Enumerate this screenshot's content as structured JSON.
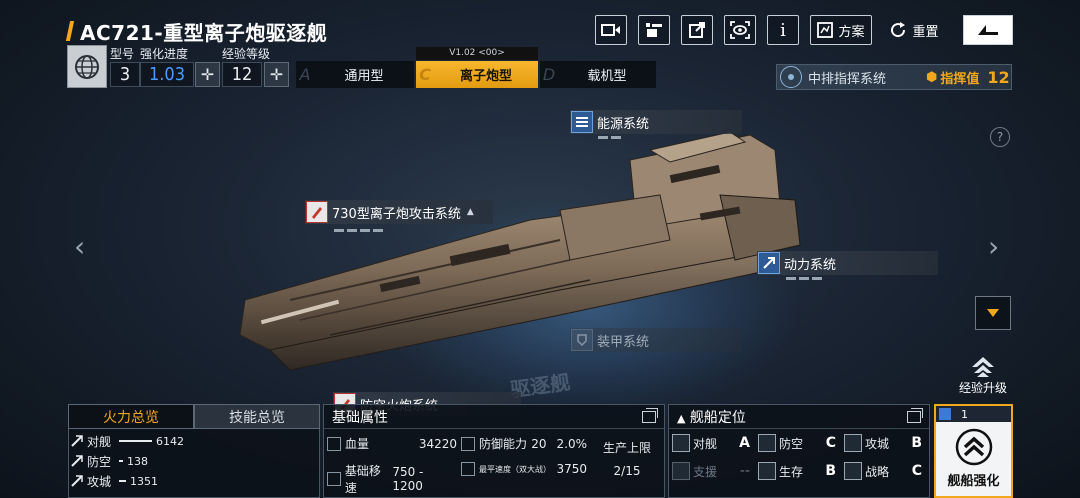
{
  "header": {
    "title": "AC721-重型离子炮驱逐舰",
    "stats": {
      "labels": [
        "型号",
        "强化进度",
        "经验等级"
      ],
      "model": "3",
      "progress": "1.03",
      "level": "12"
    },
    "buttons": {
      "plan": "方案",
      "reset": "重置"
    }
  },
  "modes": {
    "version": "V1.02 <00>",
    "tabs": [
      {
        "letter": "A",
        "label": "通用型"
      },
      {
        "letter": "C",
        "label": "离子炮型"
      },
      {
        "letter": "D",
        "label": "载机型"
      }
    ]
  },
  "command": {
    "name": "中排指挥系统",
    "value_label": "指挥值",
    "value": "12"
  },
  "systems": {
    "energy": "能源系统",
    "ion": "730型离子炮攻击系统",
    "power": "动力系统",
    "armor": "装甲系统",
    "aa": "防空火炮系统"
  },
  "watermark": "驱逐舰",
  "side": {
    "exp_up": "经验升级"
  },
  "firepower": {
    "tabs": [
      "火力总览",
      "技能总览"
    ],
    "rows": [
      {
        "label": "对舰",
        "value": "6142",
        "fill": 0.92
      },
      {
        "label": "防空",
        "value": "138",
        "fill": 0.02
      },
      {
        "label": "攻城",
        "value": "1351",
        "fill": 0.2
      }
    ]
  },
  "base": {
    "title": "基础属性",
    "hp_label": "血量",
    "hp": "34220",
    "def_label": "防御能力",
    "def": "20",
    "def_pct": "2.0%",
    "speed_label": "基础移速",
    "speed": "750 - 1200",
    "cruise_label": "最平速度（双大战）",
    "cruise": "3750",
    "prod_label": "生产上限",
    "prod": "2/15"
  },
  "position": {
    "title": "舰船定位",
    "cells": [
      {
        "label": "对舰",
        "grade": "A",
        "dim": false
      },
      {
        "label": "防空",
        "grade": "C",
        "dim": false
      },
      {
        "label": "攻城",
        "grade": "B",
        "dim": false
      },
      {
        "label": "支援",
        "grade": "--",
        "dim": true
      },
      {
        "label": "生存",
        "grade": "B",
        "dim": false
      },
      {
        "label": "战略",
        "grade": "C",
        "dim": false
      }
    ]
  },
  "enhance": {
    "count": "1",
    "label": "舰船强化"
  }
}
